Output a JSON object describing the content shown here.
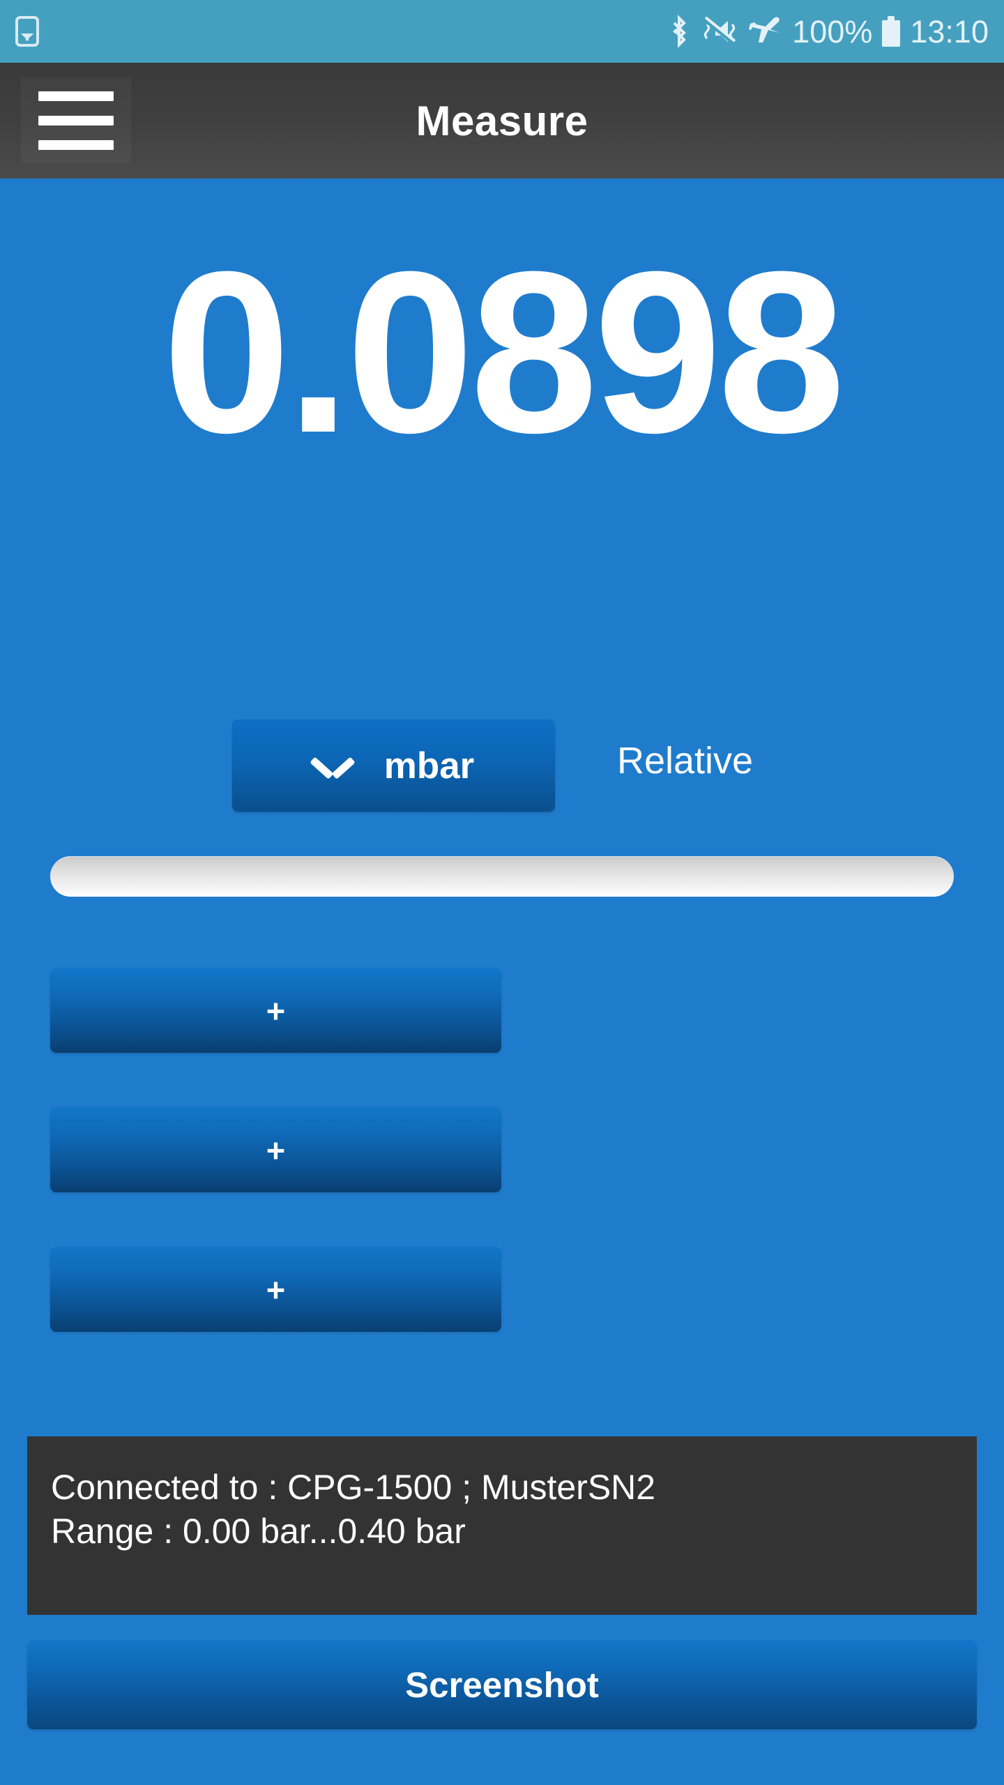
{
  "status_bar": {
    "background_color": "#45a0c0",
    "left_icon": "gallery-icon",
    "icons": [
      "bluetooth-icon",
      "vibrate-mute-icon",
      "airplane-mode-icon"
    ],
    "battery_percent": "100%",
    "battery_icon": "battery-full-icon",
    "time": "13:10"
  },
  "app_bar": {
    "menu_icon": "hamburger-menu-icon",
    "title": "Measure",
    "background_color": "#3f3f3f"
  },
  "measurement": {
    "value": "0.0898",
    "unit_button_label": "mbar",
    "unit_dropdown_icon": "chevron-down-icon",
    "mode_label": "Relative",
    "accent_color": "#1f7ccd"
  },
  "slider": {
    "name": "measurement-slider",
    "fill_percent": 0
  },
  "action_buttons": [
    {
      "label": "+",
      "name": "add-button-1"
    },
    {
      "label": "+",
      "name": "add-button-2"
    },
    {
      "label": "+",
      "name": "add-button-3"
    }
  ],
  "connection_panel": {
    "line1": "Connected to : CPG-1500 ; MusterSN2",
    "line2": "Range : 0.00 bar...0.40 bar",
    "background_color": "#333333"
  },
  "screenshot_button": {
    "label": "Screenshot"
  }
}
